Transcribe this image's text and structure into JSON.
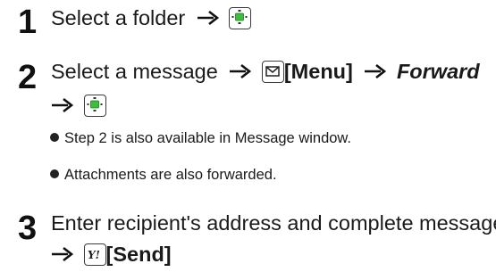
{
  "steps": [
    {
      "number": "1",
      "text": "Select a folder",
      "key_icon": "center-select-key-icon"
    },
    {
      "number": "2",
      "text": "Select a message",
      "menu_key_icon": "mail-key-icon",
      "menu_label": "[Menu]",
      "forward_label": "Forward",
      "key_icon": "center-select-key-icon",
      "notes": [
        "Step 2 is also available in Message window.",
        "Attachments are also forwarded."
      ]
    },
    {
      "number": "3",
      "text": "Enter recipient's address and complete message",
      "send_key_icon": "yahoo-key-icon",
      "send_label": "[Send]"
    }
  ],
  "colors": {
    "text": "#1a1a1a",
    "key_green": "#2eb82e"
  }
}
